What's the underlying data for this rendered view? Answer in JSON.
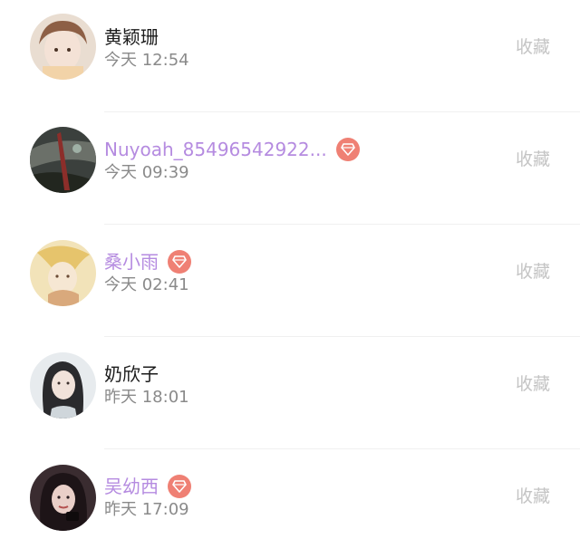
{
  "action_label": "收藏",
  "colors": {
    "vip_name": "#b58be0",
    "badge": "#ef8074",
    "time": "#8a8a8a",
    "action": "#c4c4c4"
  },
  "items": [
    {
      "name": "黄颖珊",
      "time": "今天 12:54",
      "vip": false
    },
    {
      "name": "Nuyoah_85496542922...",
      "time": "今天 09:39",
      "vip": true
    },
    {
      "name": "桑小雨",
      "time": "今天 02:41",
      "vip": true
    },
    {
      "name": "奶欣子",
      "time": "昨天 18:01",
      "vip": false
    },
    {
      "name": "吴幼西",
      "time": "昨天 17:09",
      "vip": true
    }
  ],
  "badge_icon": "diamond-icon"
}
